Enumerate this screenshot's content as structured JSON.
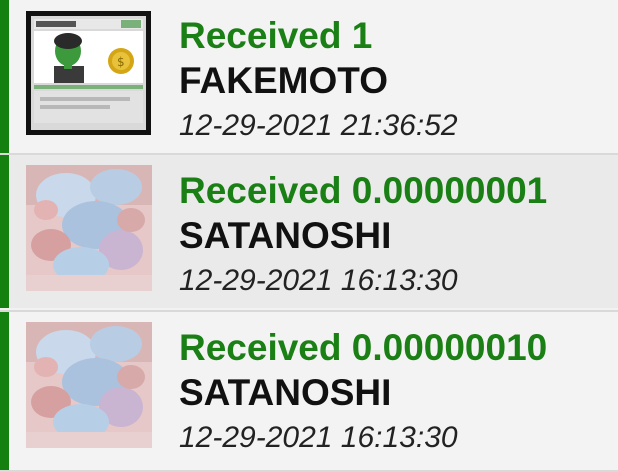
{
  "transactions": [
    {
      "amount": "Received 1",
      "asset": "FAKEMOTO",
      "date": "12-29-2021 21:36:52",
      "thumbnail": "fakemoto-card-icon"
    },
    {
      "amount": "Received 0.00000001",
      "asset": "SATANOSHI",
      "date": "12-29-2021 16:13:30",
      "thumbnail": "satanoshi-art-icon"
    },
    {
      "amount": "Received 0.00000010",
      "asset": "SATANOSHI",
      "date": "12-29-2021 16:13:30",
      "thumbnail": "satanoshi-art-icon"
    }
  ],
  "colors": {
    "accent_bar": "#13800f",
    "received_text": "#1a7f14",
    "asset_text": "#111111"
  }
}
